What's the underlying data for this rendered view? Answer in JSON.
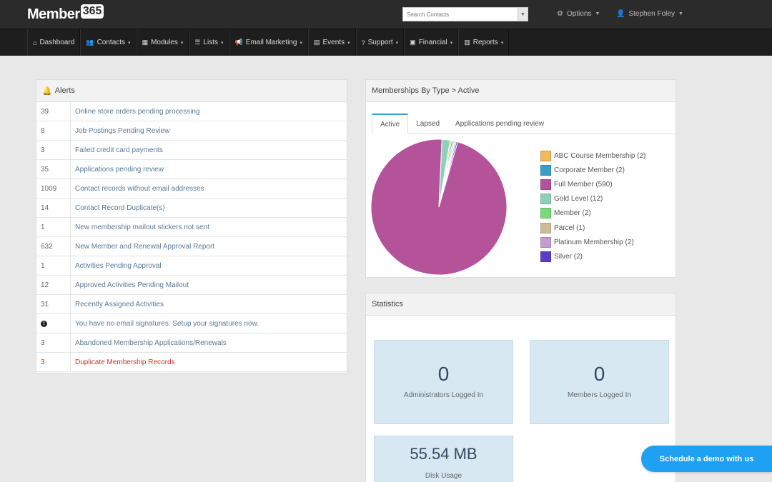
{
  "brand": {
    "name": "Member",
    "badge": "365"
  },
  "search": {
    "placeholder": "Search Contacts"
  },
  "top_links": {
    "options": "Options",
    "user": "Stephen Foley"
  },
  "nav": [
    {
      "label": "Dashboard",
      "icon": "dashboard-icon",
      "dropdown": false
    },
    {
      "label": "Contacts",
      "icon": "users-icon",
      "dropdown": true
    },
    {
      "label": "Modules",
      "icon": "modules-icon",
      "dropdown": true
    },
    {
      "label": "Lists",
      "icon": "list-icon",
      "dropdown": true
    },
    {
      "label": "Email Marketing",
      "icon": "bullhorn-icon",
      "dropdown": true
    },
    {
      "label": "Events",
      "icon": "calendar-icon",
      "dropdown": true
    },
    {
      "label": "Support",
      "icon": "question-icon",
      "dropdown": true
    },
    {
      "label": "Financial",
      "icon": "money-icon",
      "dropdown": true
    },
    {
      "label": "Reports",
      "icon": "chart-icon",
      "dropdown": true
    }
  ],
  "alerts": {
    "title": "Alerts",
    "rows": [
      {
        "count": "39",
        "text": "Online store orders pending processing"
      },
      {
        "count": "8",
        "text": "Job Postings Pending Review"
      },
      {
        "count": "3",
        "text": "Failed credit card payments"
      },
      {
        "count": "35",
        "text": "Applications pending review"
      },
      {
        "count": "1009",
        "text": "Contact records without email addresses"
      },
      {
        "count": "14",
        "text": "Contact Record Duplicate(s)"
      },
      {
        "count": "1",
        "text": "New membership mailout stickers not sent"
      },
      {
        "count": "632",
        "text": "New Member and Renewal Approval Report"
      },
      {
        "count": "1",
        "text": "Activities Pending Approval"
      },
      {
        "count": "12",
        "text": "Approved Activities Pending Mailout"
      },
      {
        "count": "31",
        "text": "Recently Assigned Activities"
      },
      {
        "count": "!",
        "text": "You have no email signatures. Setup your signatures now.",
        "info": true
      },
      {
        "count": "3",
        "text": "Abandoned Membership Applications/Renewals"
      },
      {
        "count": "3",
        "text": "Duplicate Membership Records",
        "danger": true
      }
    ]
  },
  "memberships": {
    "title": "Memberships By Type > Active",
    "tabs": [
      "Active",
      "Lapsed",
      "Applications pending review"
    ],
    "active_tab": 0
  },
  "chart_data": {
    "type": "pie",
    "series": [
      {
        "name": "ABC Course Membership (2)",
        "value": 2,
        "color": "#f0b95b"
      },
      {
        "name": "Corporate Member (2)",
        "value": 2,
        "color": "#3a9dc4"
      },
      {
        "name": "Full Member (590)",
        "value": 590,
        "color": "#b4529a"
      },
      {
        "name": "Gold Level (12)",
        "value": 12,
        "color": "#8fd0b9"
      },
      {
        "name": "Member (2)",
        "value": 2,
        "color": "#7bd97b"
      },
      {
        "name": "Parcel (1)",
        "value": 1,
        "color": "#cdbb9a"
      },
      {
        "name": "Platinum Membership (2)",
        "value": 2,
        "color": "#c79bd1"
      },
      {
        "name": "Silver (2)",
        "value": 2,
        "color": "#5b3dc8"
      }
    ]
  },
  "statistics": {
    "title": "Statistics",
    "items": [
      {
        "value": "0",
        "label": "Administrators Logged In"
      },
      {
        "value": "0",
        "label": "Members Logged In"
      },
      {
        "value": "55.54 MB",
        "label": "Disk Usage"
      }
    ]
  },
  "demo_button": "Schedule a demo with us"
}
